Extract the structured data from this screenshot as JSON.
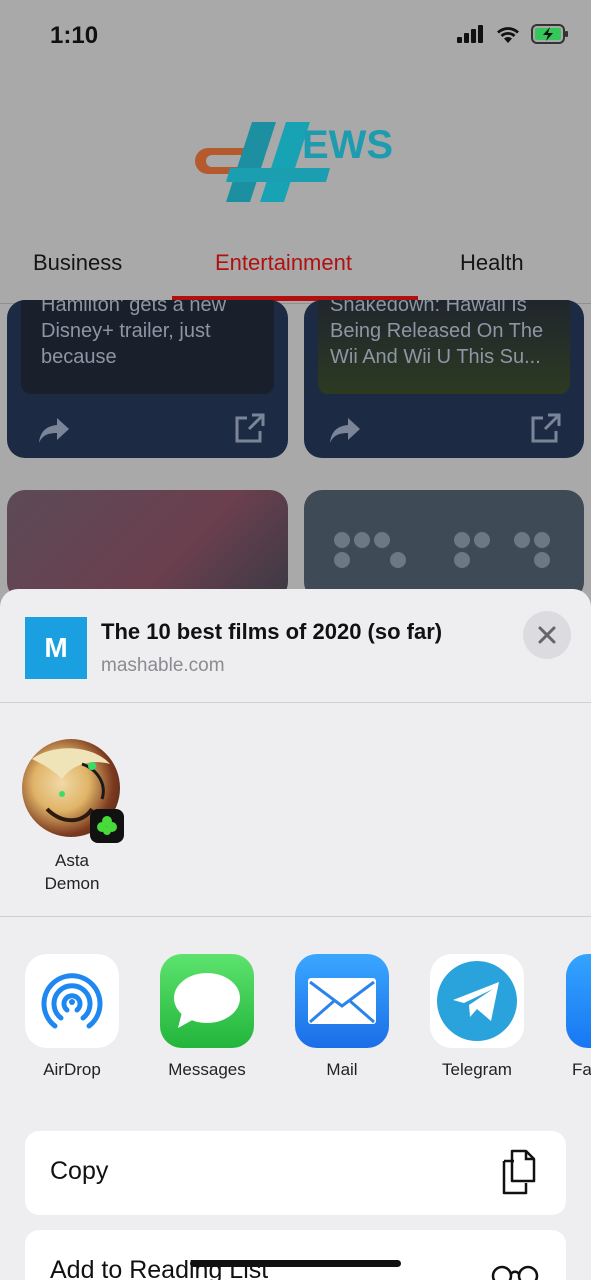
{
  "status_bar": {
    "time": "1:10"
  },
  "app": {
    "logo_text": "EWS",
    "tabs": [
      {
        "label": "Business",
        "active": false
      },
      {
        "label": "Entertainment",
        "active": true
      },
      {
        "label": "Health",
        "active": false
      }
    ],
    "cards": [
      {
        "text": "Hamilton' gets a new Disney+ trailer, just because"
      },
      {
        "text": "Shakedown: Hawaii Is Being Released On The Wii And Wii U This Su..."
      }
    ]
  },
  "share_sheet": {
    "site_icon_letter": "M",
    "title": "The 10 best films of 2020 (so far)",
    "domain": "mashable.com",
    "people": [
      {
        "name_line1": "Asta",
        "name_line2": "Demon"
      }
    ],
    "apps": [
      {
        "label": "AirDrop",
        "icon": "airdrop-icon"
      },
      {
        "label": "Messages",
        "icon": "messages-icon"
      },
      {
        "label": "Mail",
        "icon": "mail-icon"
      },
      {
        "label": "Telegram",
        "icon": "telegram-icon"
      },
      {
        "label": "Fa",
        "icon": "facebook-icon"
      }
    ],
    "actions": [
      {
        "label": "Copy",
        "icon": "copy-icon"
      },
      {
        "label": "Add to Reading List",
        "icon": "glasses-icon"
      }
    ]
  },
  "colors": {
    "accent_tab": "#b01010",
    "sheet_bg": "#eeeef0",
    "mail_blue": "#1e7cf2",
    "messages_green": "#2dc54a",
    "telegram_blue": "#2aa3dc"
  }
}
